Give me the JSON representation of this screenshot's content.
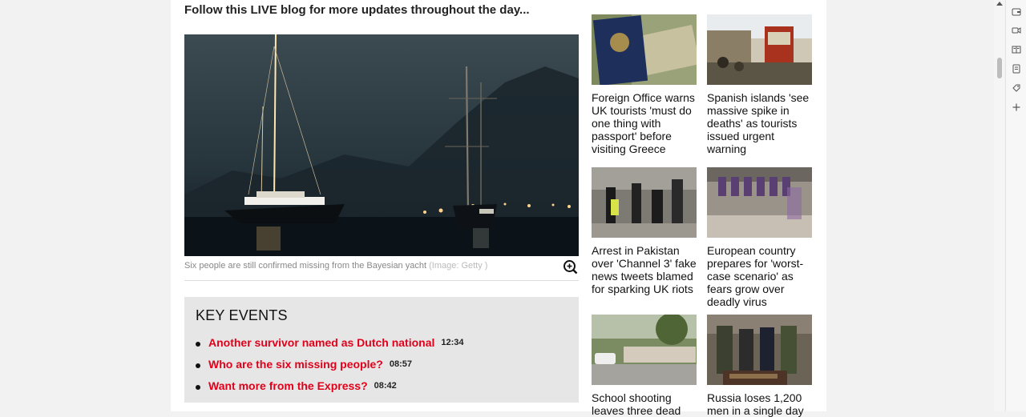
{
  "article": {
    "lead": "Follow this LIVE blog for more updates throughout the day...",
    "image_caption": "Six people are still confirmed missing from the Bayesian yacht",
    "image_credit": "(Image: Getty )"
  },
  "key_events": {
    "heading": "KEY EVENTS",
    "items": [
      {
        "label": "Another survivor named as Dutch national",
        "time": "12:34"
      },
      {
        "label": "Who are the six missing people?",
        "time": "08:57"
      },
      {
        "label": "Want more from the Express?",
        "time": "08:42"
      }
    ]
  },
  "related": [
    {
      "title": "Foreign Office warns UK tourists 'must do one thing with passport' before visiting Greece"
    },
    {
      "title": "Spanish islands 'see massive spike in deaths' as tourists issued urgent warning"
    },
    {
      "title": "Arrest in Pakistan over 'Channel 3' fake news tweets blamed for sparking UK riots"
    },
    {
      "title": "European country prepares for 'worst-case scenario' as fears grow over deadly virus"
    },
    {
      "title": "School shooting leaves three dead"
    },
    {
      "title": "Russia loses 1,200 men in a single day"
    }
  ],
  "colors": {
    "accent": "#e2001a",
    "key_bg": "#e6e6e6"
  },
  "browser_sidebar": {
    "icons": [
      "wallet-icon",
      "video-icon",
      "reader-icon",
      "collections-icon",
      "shopping-icon",
      "add-icon"
    ]
  }
}
